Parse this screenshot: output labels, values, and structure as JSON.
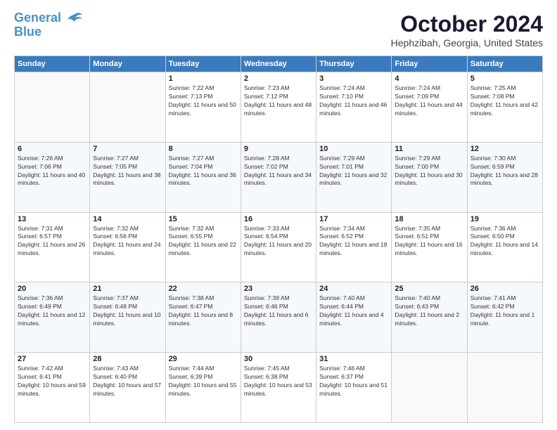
{
  "header": {
    "logo_line1": "General",
    "logo_line2": "Blue",
    "month": "October 2024",
    "location": "Hephzibah, Georgia, United States"
  },
  "days_of_week": [
    "Sunday",
    "Monday",
    "Tuesday",
    "Wednesday",
    "Thursday",
    "Friday",
    "Saturday"
  ],
  "weeks": [
    [
      {
        "day": "",
        "empty": true
      },
      {
        "day": "",
        "empty": true
      },
      {
        "day": "1",
        "sunrise": "7:22 AM",
        "sunset": "7:13 PM",
        "daylight": "11 hours and 50 minutes."
      },
      {
        "day": "2",
        "sunrise": "7:23 AM",
        "sunset": "7:12 PM",
        "daylight": "11 hours and 48 minutes."
      },
      {
        "day": "3",
        "sunrise": "7:24 AM",
        "sunset": "7:10 PM",
        "daylight": "11 hours and 46 minutes."
      },
      {
        "day": "4",
        "sunrise": "7:24 AM",
        "sunset": "7:09 PM",
        "daylight": "11 hours and 44 minutes."
      },
      {
        "day": "5",
        "sunrise": "7:25 AM",
        "sunset": "7:08 PM",
        "daylight": "11 hours and 42 minutes."
      }
    ],
    [
      {
        "day": "6",
        "sunrise": "7:26 AM",
        "sunset": "7:06 PM",
        "daylight": "11 hours and 40 minutes."
      },
      {
        "day": "7",
        "sunrise": "7:27 AM",
        "sunset": "7:05 PM",
        "daylight": "11 hours and 38 minutes."
      },
      {
        "day": "8",
        "sunrise": "7:27 AM",
        "sunset": "7:04 PM",
        "daylight": "11 hours and 36 minutes."
      },
      {
        "day": "9",
        "sunrise": "7:28 AM",
        "sunset": "7:02 PM",
        "daylight": "11 hours and 34 minutes."
      },
      {
        "day": "10",
        "sunrise": "7:29 AM",
        "sunset": "7:01 PM",
        "daylight": "11 hours and 32 minutes."
      },
      {
        "day": "11",
        "sunrise": "7:29 AM",
        "sunset": "7:00 PM",
        "daylight": "11 hours and 30 minutes."
      },
      {
        "day": "12",
        "sunrise": "7:30 AM",
        "sunset": "6:59 PM",
        "daylight": "11 hours and 28 minutes."
      }
    ],
    [
      {
        "day": "13",
        "sunrise": "7:31 AM",
        "sunset": "6:57 PM",
        "daylight": "11 hours and 26 minutes."
      },
      {
        "day": "14",
        "sunrise": "7:32 AM",
        "sunset": "6:56 PM",
        "daylight": "11 hours and 24 minutes."
      },
      {
        "day": "15",
        "sunrise": "7:32 AM",
        "sunset": "6:55 PM",
        "daylight": "11 hours and 22 minutes."
      },
      {
        "day": "16",
        "sunrise": "7:33 AM",
        "sunset": "6:54 PM",
        "daylight": "11 hours and 20 minutes."
      },
      {
        "day": "17",
        "sunrise": "7:34 AM",
        "sunset": "6:52 PM",
        "daylight": "11 hours and 18 minutes."
      },
      {
        "day": "18",
        "sunrise": "7:35 AM",
        "sunset": "6:51 PM",
        "daylight": "11 hours and 16 minutes."
      },
      {
        "day": "19",
        "sunrise": "7:36 AM",
        "sunset": "6:50 PM",
        "daylight": "11 hours and 14 minutes."
      }
    ],
    [
      {
        "day": "20",
        "sunrise": "7:36 AM",
        "sunset": "6:49 PM",
        "daylight": "11 hours and 12 minutes."
      },
      {
        "day": "21",
        "sunrise": "7:37 AM",
        "sunset": "6:48 PM",
        "daylight": "11 hours and 10 minutes."
      },
      {
        "day": "22",
        "sunrise": "7:38 AM",
        "sunset": "6:47 PM",
        "daylight": "11 hours and 8 minutes."
      },
      {
        "day": "23",
        "sunrise": "7:39 AM",
        "sunset": "6:46 PM",
        "daylight": "11 hours and 6 minutes."
      },
      {
        "day": "24",
        "sunrise": "7:40 AM",
        "sunset": "6:44 PM",
        "daylight": "11 hours and 4 minutes."
      },
      {
        "day": "25",
        "sunrise": "7:40 AM",
        "sunset": "6:43 PM",
        "daylight": "11 hours and 2 minutes."
      },
      {
        "day": "26",
        "sunrise": "7:41 AM",
        "sunset": "6:42 PM",
        "daylight": "11 hours and 1 minute."
      }
    ],
    [
      {
        "day": "27",
        "sunrise": "7:42 AM",
        "sunset": "6:41 PM",
        "daylight": "10 hours and 59 minutes."
      },
      {
        "day": "28",
        "sunrise": "7:43 AM",
        "sunset": "6:40 PM",
        "daylight": "10 hours and 57 minutes."
      },
      {
        "day": "29",
        "sunrise": "7:44 AM",
        "sunset": "6:39 PM",
        "daylight": "10 hours and 55 minutes."
      },
      {
        "day": "30",
        "sunrise": "7:45 AM",
        "sunset": "6:38 PM",
        "daylight": "10 hours and 53 minutes."
      },
      {
        "day": "31",
        "sunrise": "7:46 AM",
        "sunset": "6:37 PM",
        "daylight": "10 hours and 51 minutes."
      },
      {
        "day": "",
        "empty": true
      },
      {
        "day": "",
        "empty": true
      }
    ]
  ]
}
